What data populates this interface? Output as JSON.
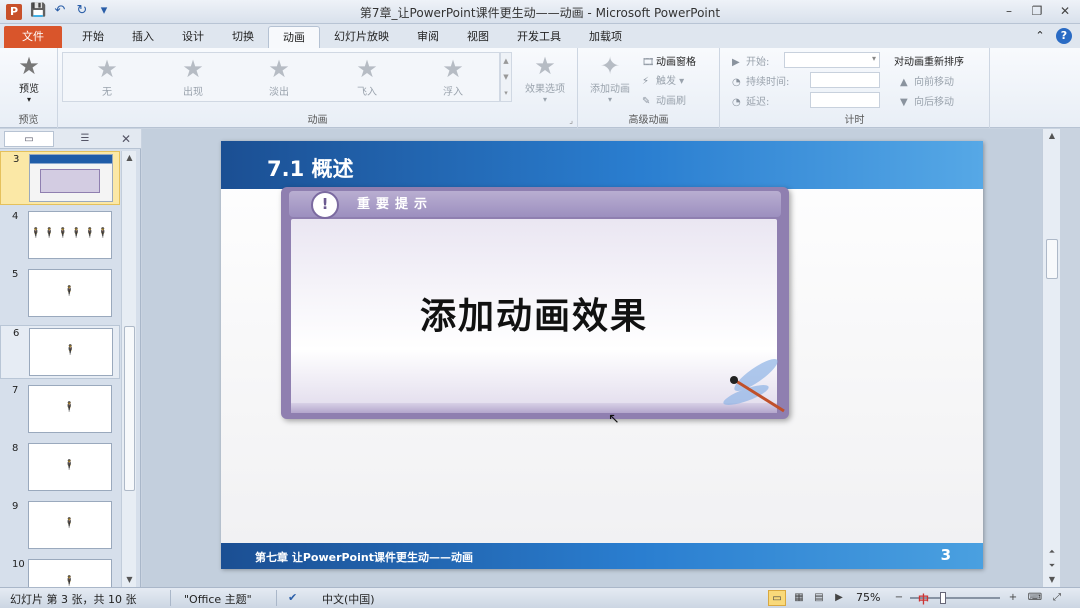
{
  "titlebar": {
    "app_icon": "P",
    "title": "第7章_让PowerPoint课件更生动——动画  -  Microsoft PowerPoint",
    "qat": [
      "save-icon",
      "undo-icon",
      "redo-icon",
      "customize-icon"
    ]
  },
  "tabs": [
    "文件",
    "开始",
    "插入",
    "设计",
    "切换",
    "动画",
    "幻灯片放映",
    "审阅",
    "视图",
    "开发工具",
    "加载项"
  ],
  "active_tab": "动画",
  "ribbon": {
    "preview": {
      "label": "预览",
      "group": "预览"
    },
    "animation_gallery": [
      "无",
      "出现",
      "淡出",
      "飞入",
      "浮入"
    ],
    "effect_options": "效果选项",
    "animation_group": "动画",
    "add_animation": "添加动画",
    "animation_pane": "动画窗格",
    "trigger": "触发",
    "animation_painter": "动画刷",
    "advanced_group": "高级动画",
    "start_label": "开始:",
    "duration_label": "持续时间:",
    "delay_label": "延迟:",
    "reorder_title": "对动画重新排序",
    "move_earlier": "向前移动",
    "move_later": "向后移动",
    "timing_group": "计时"
  },
  "slides_panel": {
    "close": "✕",
    "items": [
      {
        "num": "3",
        "mini": ""
      },
      {
        "num": "4",
        "mini": "🕴🕴🕴🕴🕴🕴"
      },
      {
        "num": "5",
        "mini": "🕴"
      },
      {
        "num": "6",
        "mini": "🕴"
      },
      {
        "num": "7",
        "mini": "🕴"
      },
      {
        "num": "8",
        "mini": "🕴"
      },
      {
        "num": "9",
        "mini": "🕴"
      },
      {
        "num": "10",
        "mini": "🕴"
      }
    ]
  },
  "slide": {
    "title": "7.1 概述",
    "tip": "重要提示",
    "main_text": "添加动画效果",
    "footer": "第七章    让PowerPoint课件更生动——动画",
    "page_number": "3"
  },
  "statusbar": {
    "slide_info": "幻灯片 第 3 张，共 10 张",
    "theme": "\"Office 主题\"",
    "language": "中文(中国)",
    "zoom": "75%",
    "ime": "中"
  },
  "colors": {
    "file_tab": "#d9552b",
    "slide_header": "#1b4f93",
    "card": "#8f7fb0"
  }
}
